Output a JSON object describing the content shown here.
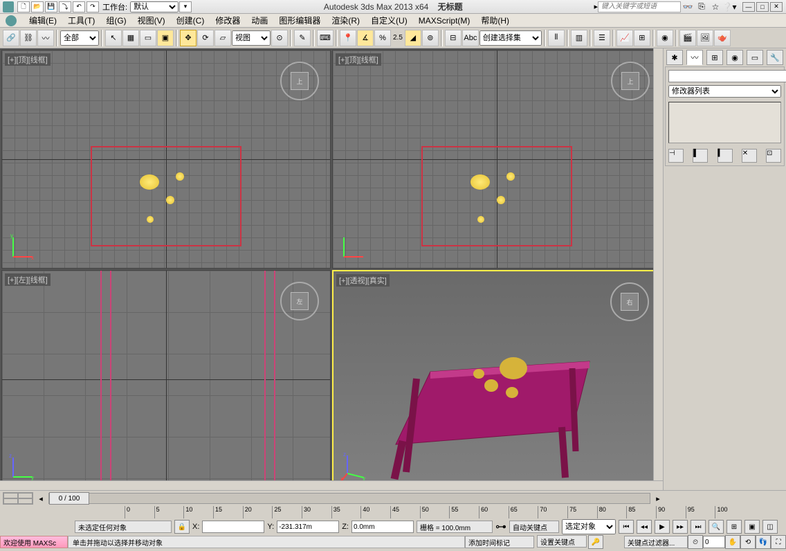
{
  "titlebar": {
    "workspace_label": "工作台:",
    "workspace_value": "默认",
    "app_title": "Autodesk 3ds Max  2013 x64",
    "doc_title": "无标题",
    "search_placeholder": "键入关键字或短语"
  },
  "menus": [
    "编辑(E)",
    "工具(T)",
    "组(G)",
    "视图(V)",
    "创建(C)",
    "修改器",
    "动画",
    "图形编辑器",
    "渲染(R)",
    "自定义(U)",
    "MAXScript(M)",
    "帮助(H)"
  ],
  "toolbar": {
    "filter": "全部",
    "refsys": "视图",
    "spinner": "2.5",
    "named_sel": "创建选择集"
  },
  "viewports": {
    "top1": "[+][顶][线框]",
    "top2": "[+][顶][线框]",
    "left": "[+][左][线框]",
    "persp": "[+][透视][真实]",
    "cube_top": "上",
    "cube_left": "左",
    "cube_persp": "右"
  },
  "side_panel": {
    "modifier_list": "修改器列表"
  },
  "timeline": {
    "frame_display": "0 / 100",
    "ticks": [
      "0",
      "5",
      "10",
      "15",
      "20",
      "25",
      "30",
      "35",
      "40",
      "45",
      "50",
      "55",
      "60",
      "65",
      "70",
      "75",
      "80",
      "85",
      "90",
      "95",
      "100"
    ]
  },
  "status": {
    "selection": "未选定任何对象",
    "x_label": "X:",
    "x_val": "",
    "y_label": "Y:",
    "y_val": "-231.317m",
    "z_label": "Z:",
    "z_val": "0.0mm",
    "grid": "栅格 = 100.0mm",
    "autokey": "自动关键点",
    "sel_obj": "选定对象",
    "setkey": "设置关键点",
    "keyfilter": "关键点过滤器...",
    "frame_num": "0"
  },
  "prompts": {
    "welcome": "欢迎使用 MAXSc",
    "hint": "单击并拖动以选择并移动对象",
    "add_marker": "添加时间标记"
  }
}
